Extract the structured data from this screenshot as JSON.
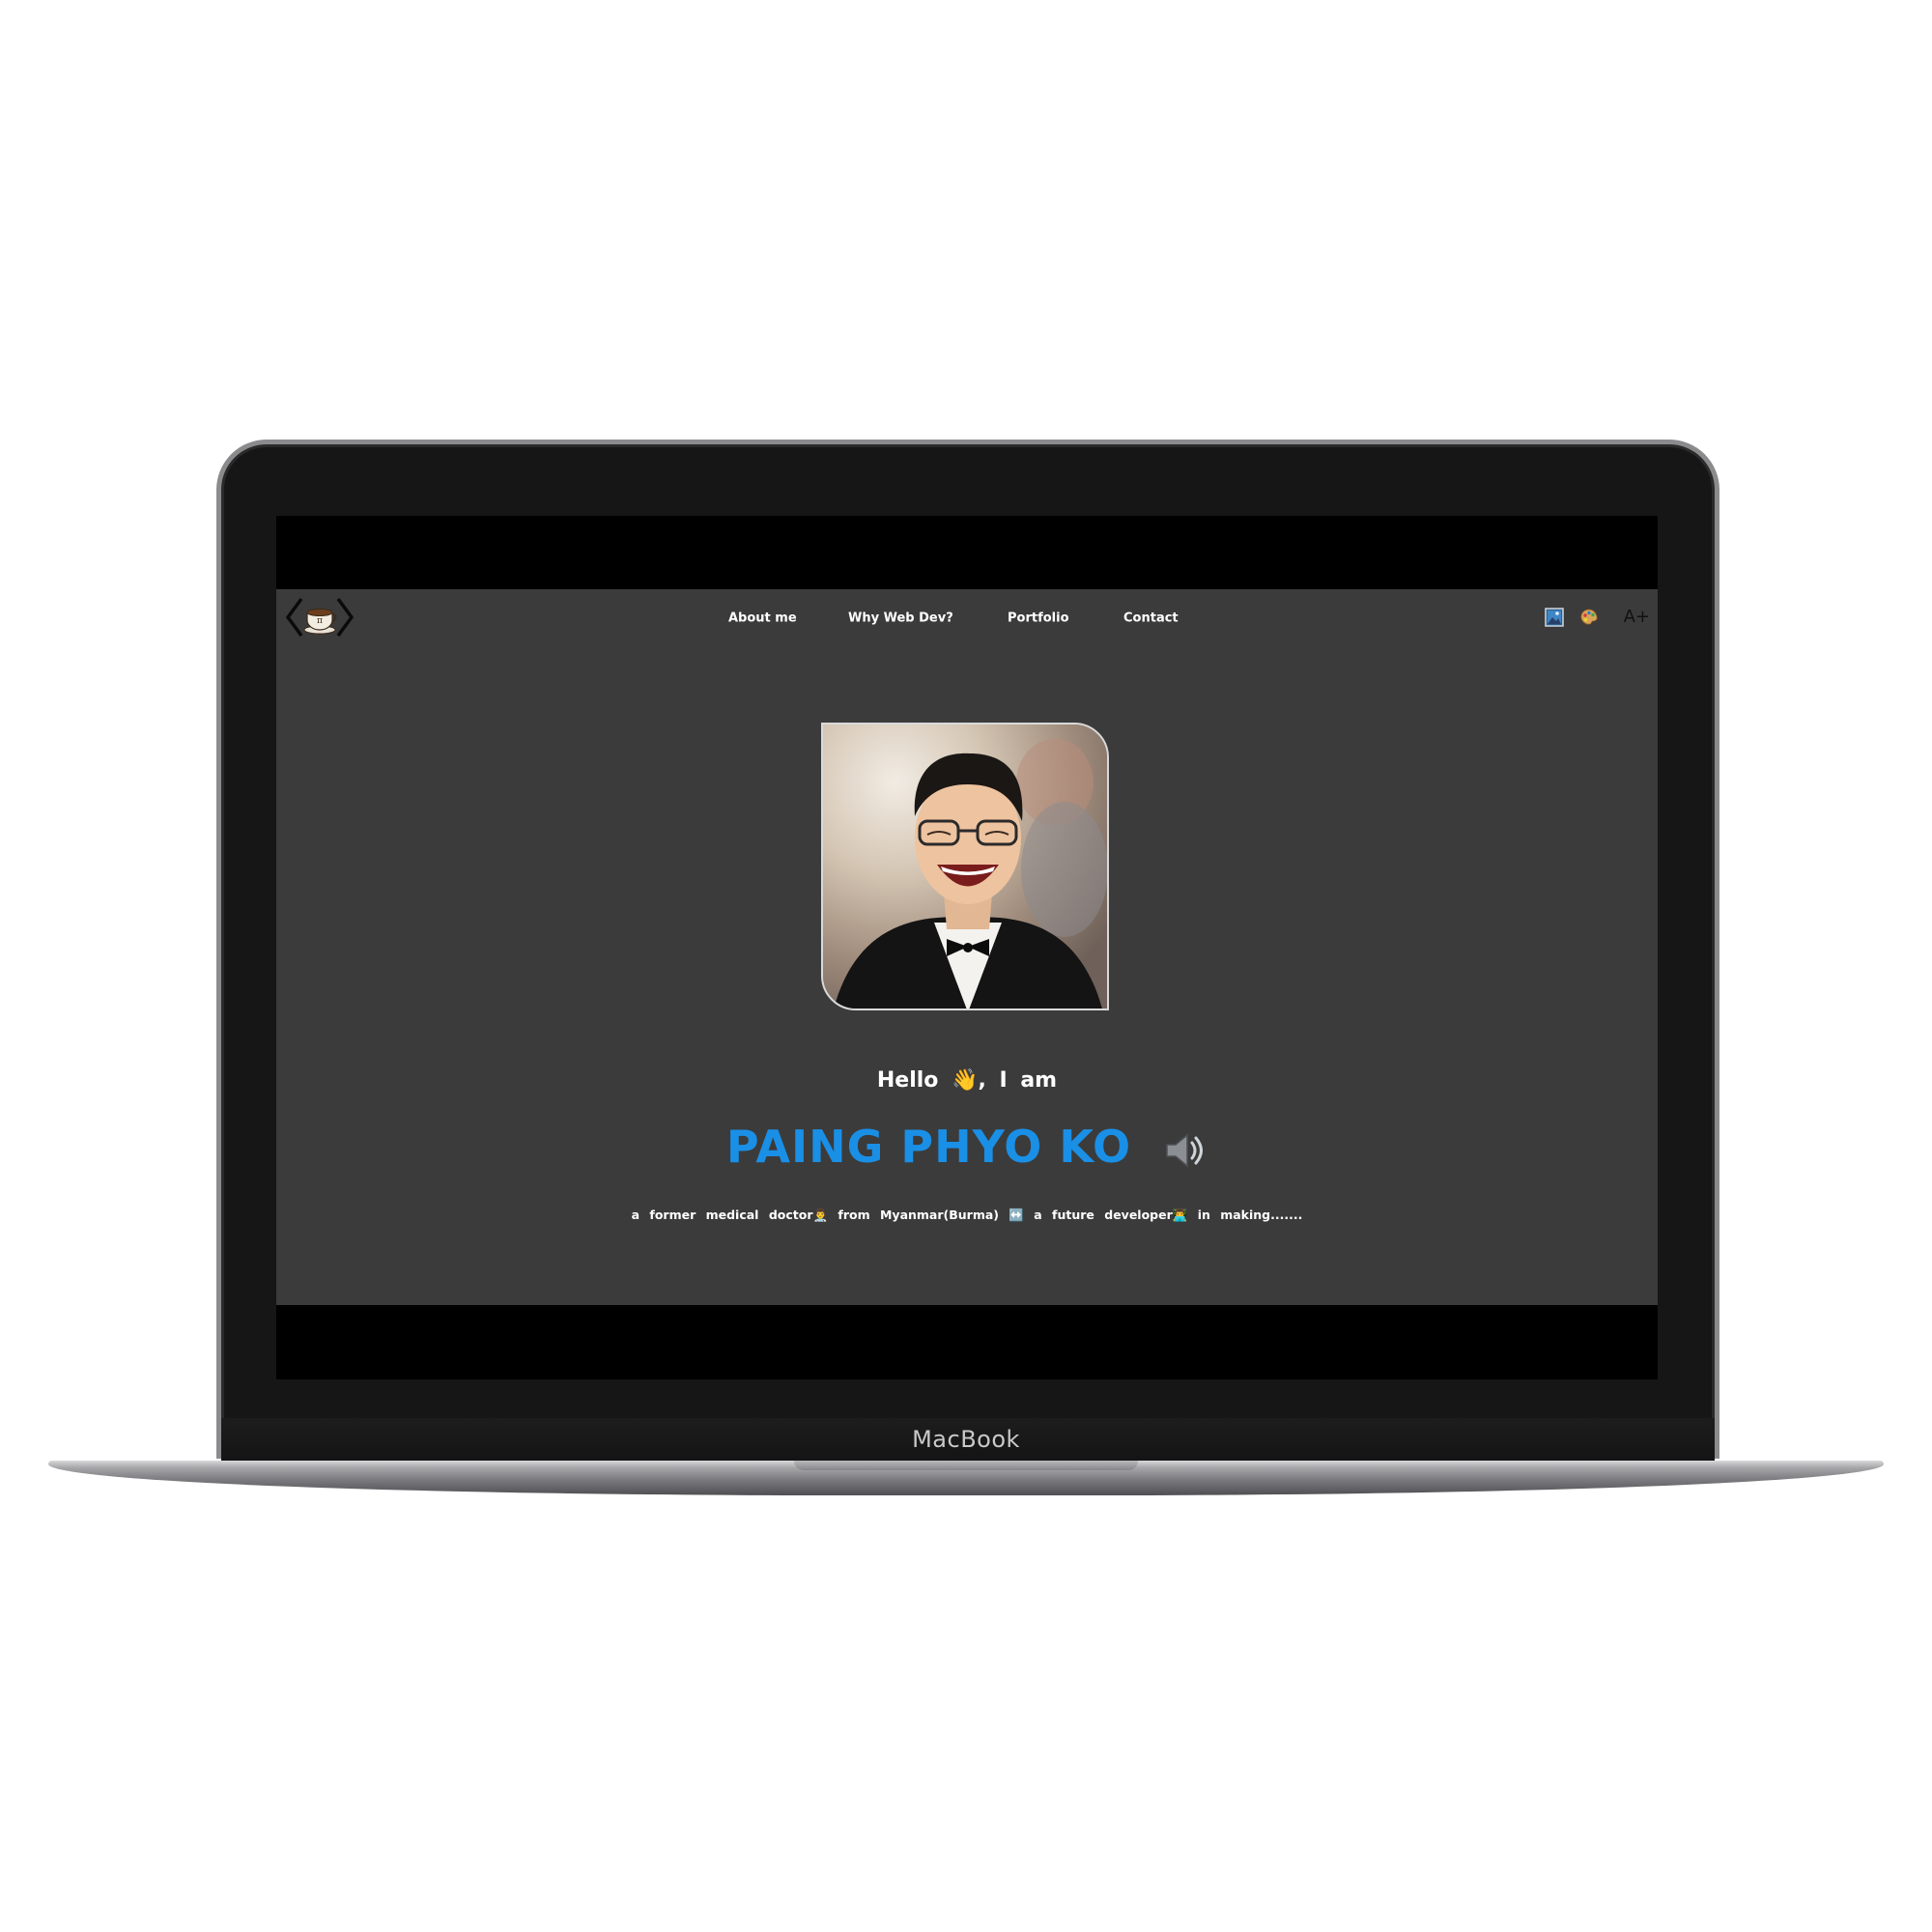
{
  "device": {
    "brand_label": "MacBook"
  },
  "site": {
    "logo_icon": "coffee-cup-pi-code-icon",
    "nav": {
      "items": [
        {
          "label": "About me"
        },
        {
          "label": "Why Web Dev?"
        },
        {
          "label": "Portfolio"
        },
        {
          "label": "Contact"
        }
      ]
    },
    "tools": {
      "image_toggle_icon": "picture-icon",
      "theme_toggle_icon": "palette-icon",
      "font_size_label": "A+"
    },
    "hero": {
      "photo_icon": "profile-photo",
      "greeting": "Hello 👋, I am",
      "name": "PAING PHYO KO",
      "name_audio_icon": "speaker-icon",
      "tagline": "a former medical doctor👨‍⚕️ from Myanmar(Burma) ↔️ a future developer👨‍💻 in making.......",
      "accent_color": "#1a8fe6",
      "background_color": "#3b3b3b"
    }
  }
}
